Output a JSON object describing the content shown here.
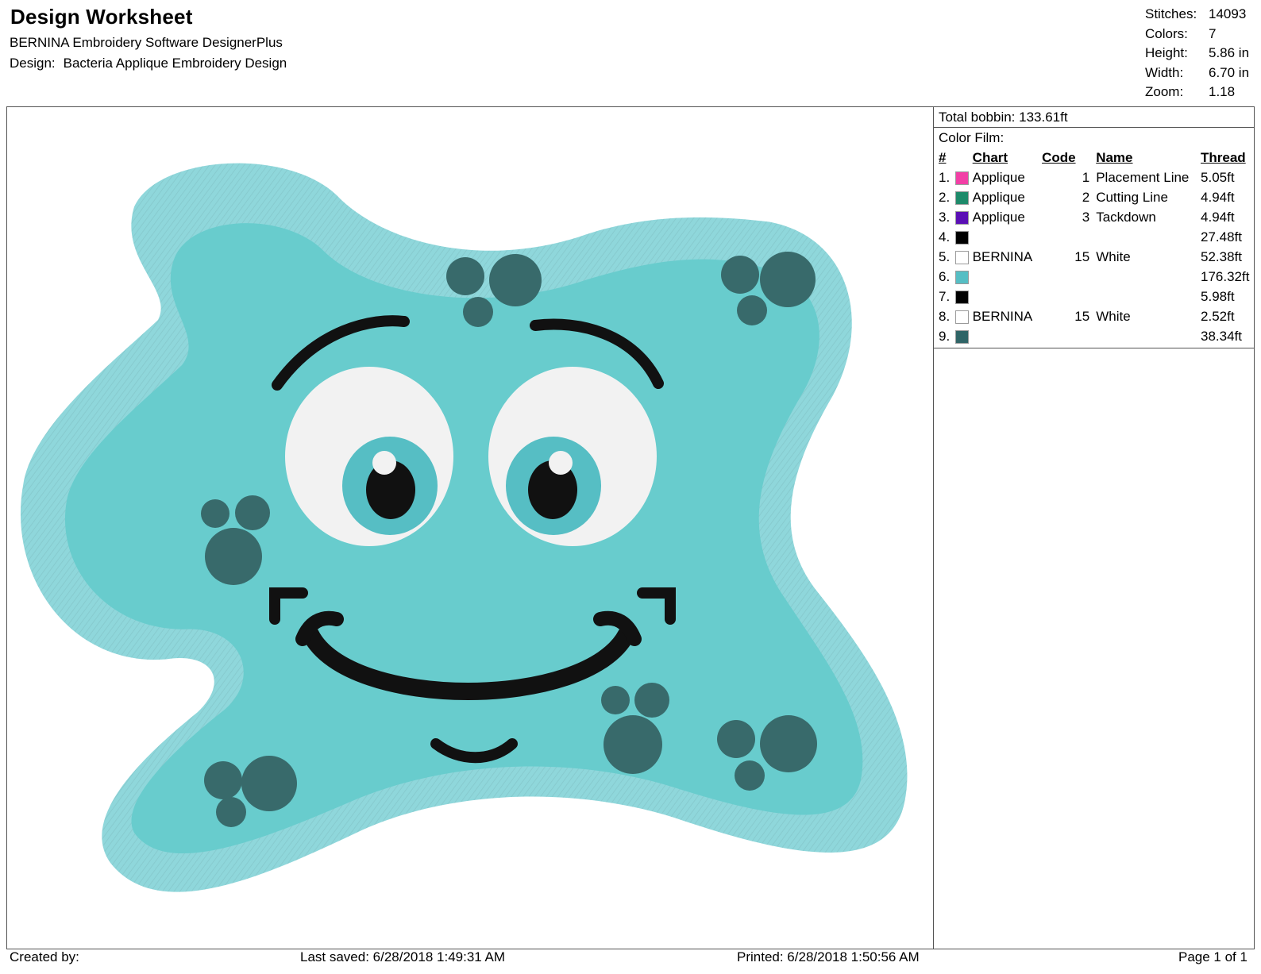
{
  "header": {
    "title": "Design Worksheet",
    "software": "BERNINA Embroidery Software DesignerPlus",
    "design_label": "Design:",
    "design_name": "Bacteria Applique Embroidery Design"
  },
  "stats": [
    {
      "label": "Stitches:",
      "value": "14093"
    },
    {
      "label": "Colors:",
      "value": "7"
    },
    {
      "label": "Height:",
      "value": "5.86 in"
    },
    {
      "label": "Width:",
      "value": "6.70 in"
    },
    {
      "label": "Zoom:",
      "value": "1.18"
    }
  ],
  "panel": {
    "bobbin_label": "Total bobbin:",
    "bobbin_value": "133.61ft",
    "film_label": "Color Film:",
    "columns": {
      "num": "#",
      "chart": "Chart",
      "code": "Code",
      "name": "Name",
      "thread": "Thread"
    },
    "rows": [
      {
        "num": "1.",
        "color": "#f23fa6",
        "chart": "Applique",
        "code": "1",
        "name": "Placement Line",
        "thread": "5.05ft"
      },
      {
        "num": "2.",
        "color": "#1e8a6a",
        "chart": "Applique",
        "code": "2",
        "name": "Cutting Line",
        "thread": "4.94ft"
      },
      {
        "num": "3.",
        "color": "#5a0fb5",
        "chart": "Applique",
        "code": "3",
        "name": "Tackdown",
        "thread": "4.94ft"
      },
      {
        "num": "4.",
        "color": "#000000",
        "chart": "",
        "code": "",
        "name": "",
        "thread": "27.48ft"
      },
      {
        "num": "5.",
        "color": "#ffffff",
        "chart": "BERNINA",
        "code": "15",
        "name": "White",
        "thread": "52.38ft"
      },
      {
        "num": "6.",
        "color": "#56bec4",
        "chart": "",
        "code": "",
        "name": "",
        "thread": "176.32ft"
      },
      {
        "num": "7.",
        "color": "#000000",
        "chart": "",
        "code": "",
        "name": "",
        "thread": "5.98ft"
      },
      {
        "num": "8.",
        "color": "#ffffff",
        "chart": "BERNINA",
        "code": "15",
        "name": "White",
        "thread": "2.52ft"
      },
      {
        "num": "9.",
        "color": "#2f6466",
        "chart": "",
        "code": "",
        "name": "",
        "thread": "38.34ft"
      }
    ]
  },
  "footer": {
    "created": "Created by:",
    "saved": "Last saved: 6/28/2018 1:49:31 AM",
    "printed": "Printed: 6/28/2018 1:50:56 AM",
    "page": "Page 1 of 1"
  },
  "design_colors": {
    "body": "#68cccd",
    "border": "#8fd7db",
    "spots": "#386a6b",
    "eye_white": "#f2f2f2",
    "iris": "#56bec4",
    "outline": "#111111"
  }
}
